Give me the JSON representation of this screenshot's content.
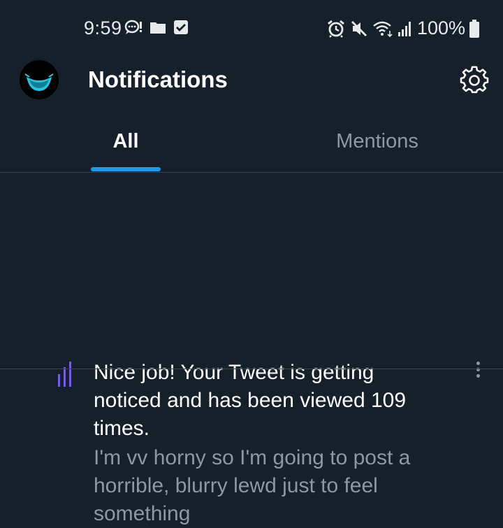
{
  "status_bar": {
    "time": "9:59",
    "left_icons": [
      "chat-bubble-icon",
      "folder-icon",
      "checkbox-icon"
    ],
    "right_icons": [
      "alarm-icon",
      "mute-icon",
      "wifi-icon",
      "signal-icon",
      "battery-icon"
    ],
    "battery": "100%"
  },
  "header": {
    "title": "Notifications",
    "settings_icon": "gear-icon"
  },
  "tabs": [
    {
      "label": "All",
      "active": true
    },
    {
      "label": "Mentions",
      "active": false
    }
  ],
  "notifications": [
    {
      "icon": "analytics-bars-icon",
      "text": "Nice job! Your Tweet is getting noticed and has been viewed 109 times.",
      "preview": "I'm vv horny so I'm going to post a horrible, blurry lewd just to feel something"
    }
  ],
  "colors": {
    "background": "#15202b",
    "accent": "#1d9bf0",
    "muted_text": "#8b98a5",
    "analytics_icon": "#7856ff"
  }
}
